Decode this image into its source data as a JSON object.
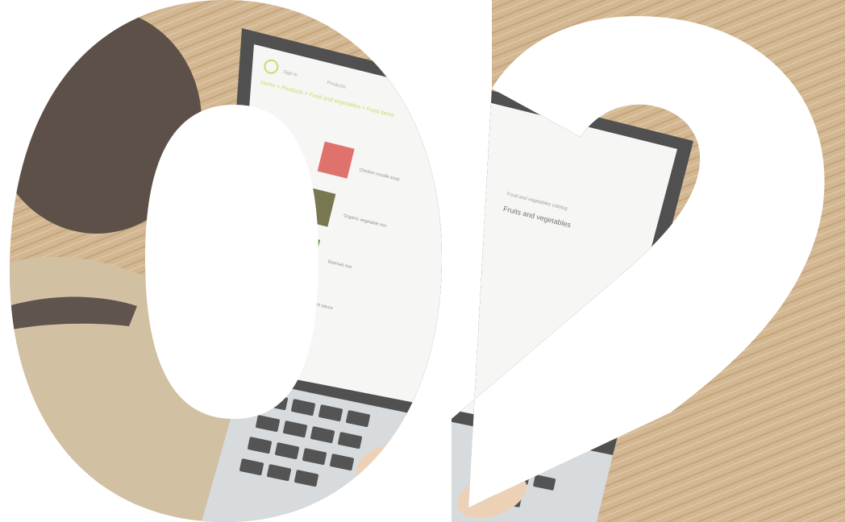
{
  "title": "02",
  "photo": {
    "subject": "person-typing-on-laptop",
    "surface_color": "#c9a87a",
    "wood_dark": "#b8935f",
    "wood_light": "#dcc29b",
    "sweater_color": "#c8b38e",
    "laptop_bezel": "#2a2a2a",
    "laptop_body": "#cfd3d6",
    "screen_color": "#f4f4f2"
  },
  "screen": {
    "breadcrumb": "Home > Products > Food and vegetables > Food items",
    "nav_1": "Products",
    "nav_2": "Sign in",
    "category_title": "Fruits and vegetables",
    "category_sub": "Food and vegetables catalog",
    "items": [
      "Chicken noodle soup",
      "Organic vegetable mix",
      "Basmati rice",
      "Hot sauce"
    ],
    "accent_color": "#b6d94b"
  }
}
